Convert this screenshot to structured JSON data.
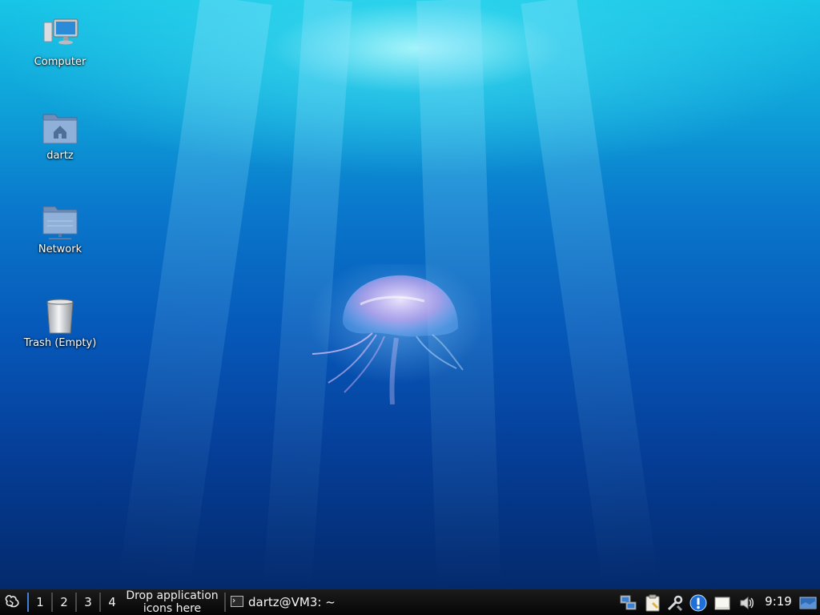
{
  "desktop": {
    "icons": [
      {
        "label": "Computer",
        "icon": "computer-icon"
      },
      {
        "label": "dartz",
        "icon": "home-folder-icon"
      },
      {
        "label": "Network",
        "icon": "network-folder-icon"
      },
      {
        "label": "Trash (Empty)",
        "icon": "trash-icon"
      }
    ],
    "wallpaper": "jellyfish-underwater"
  },
  "taskbar": {
    "menu_icon": "xfce-mouse-icon",
    "workspaces": [
      "1",
      "2",
      "3",
      "4"
    ],
    "active_workspace": "1",
    "launcher_placeholder_line1": "Drop application",
    "launcher_placeholder_line2": "icons here",
    "tasks": [
      {
        "label": "dartz@VM3: ~",
        "icon": "terminal-icon"
      }
    ],
    "tray_icons": [
      "network-manager-icon",
      "clipboard-icon",
      "tools-icon",
      "update-notifier-icon",
      "notes-icon",
      "volume-icon"
    ],
    "clock": "9:19",
    "show_desktop_icon": "show-desktop-icon"
  },
  "colors": {
    "taskbar_bg": "#0a0a0a",
    "active_workspace_accent": "#3f7fd6",
    "update_notifier": "#1e6fd9"
  }
}
